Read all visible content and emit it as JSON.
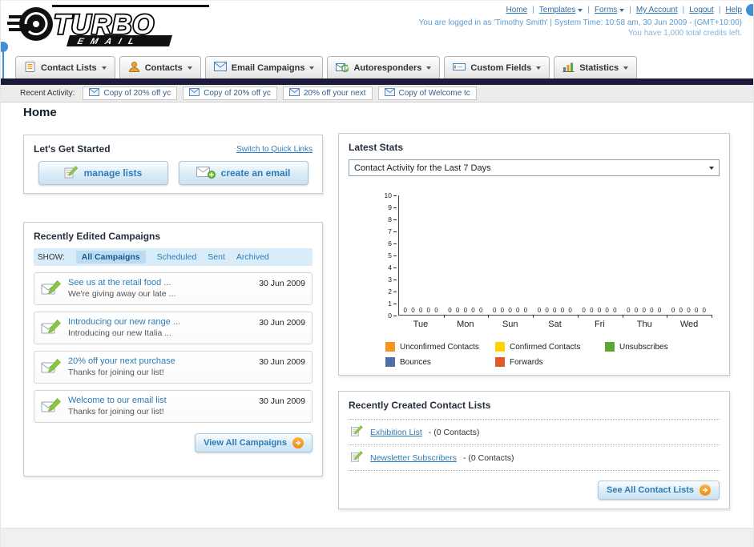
{
  "colors": {
    "link_blue": "#2d7cb8",
    "nav_strip": "#1c1c3a",
    "button_arrow_orange": "#f28a18",
    "filter_bar_blue": "#d9ecf9"
  },
  "header": {
    "logo_primary": "TURBO",
    "logo_secondary": "EMAIL",
    "separator": "|",
    "links": [
      {
        "label": "Home"
      },
      {
        "label": "Templates"
      },
      {
        "label": "Forms"
      },
      {
        "label": "My Account"
      },
      {
        "label": "Logout"
      },
      {
        "label": "Help"
      }
    ],
    "login_info": "You are logged in as 'Timothy Smith' | System Time: 10:58 am, 30 Jun 2009 - (GMT+10:00)",
    "credits_info": "You have 1,000 total credits left."
  },
  "nav_tabs": [
    {
      "label": "Contact Lists"
    },
    {
      "label": "Contacts"
    },
    {
      "label": "Email Campaigns"
    },
    {
      "label": "Autoresponders"
    },
    {
      "label": "Custom Fields"
    },
    {
      "label": "Statistics"
    }
  ],
  "recent_activity": {
    "label": "Recent Activity:",
    "items": [
      "Copy of 20% off yc",
      "Copy of 20% off yc",
      "20% off your next",
      "Copy of Welcome tc"
    ]
  },
  "page": {
    "title": "Home"
  },
  "get_started": {
    "title": "Let's Get Started",
    "quick_links_label": "Switch to Quick Links",
    "manage_lists_label": "manage lists",
    "create_email_label": "create an email"
  },
  "campaigns": {
    "title": "Recently Edited Campaigns",
    "show_label": "SHOW:",
    "filters": [
      "All Campaigns",
      "Scheduled",
      "Sent",
      "Archived"
    ],
    "selected_filter": "All Campaigns",
    "items": [
      {
        "title": "See us at the retail food ...",
        "subtitle": "We're giving away our late ...",
        "date": "30 Jun 2009"
      },
      {
        "title": "Introducing our new range ...",
        "subtitle": "Introducing our new Italia ...",
        "date": "30 Jun 2009"
      },
      {
        "title": "20% off your next purchase",
        "subtitle": "Thanks for joining our list!",
        "date": "30 Jun 2009"
      },
      {
        "title": "Welcome to our email list",
        "subtitle": "Thanks for joining our list!",
        "date": "30 Jun 2009"
      }
    ],
    "view_all_label": "View All Campaigns"
  },
  "stats": {
    "title": "Latest Stats",
    "period_selector": "Contact Activity for the Last 7 Days",
    "chart_data": {
      "type": "bar",
      "title": "Contact Activity for the Last 7 Days",
      "categories": [
        "Tue",
        "Mon",
        "Sun",
        "Sat",
        "Fri",
        "Thu",
        "Wed"
      ],
      "series": [
        {
          "name": "Unconfirmed Contacts",
          "color": "#f7941d",
          "values": [
            0,
            0,
            0,
            0,
            0,
            0,
            0
          ]
        },
        {
          "name": "Confirmed Contacts",
          "color": "#ffd200",
          "values": [
            0,
            0,
            0,
            0,
            0,
            0,
            0
          ]
        },
        {
          "name": "Unsubscribes",
          "color": "#5aa733",
          "values": [
            0,
            0,
            0,
            0,
            0,
            0,
            0
          ]
        },
        {
          "name": "Bounces",
          "color": "#4f6fa8",
          "values": [
            0,
            0,
            0,
            0,
            0,
            0,
            0
          ]
        },
        {
          "name": "Forwards",
          "color": "#e05a2b",
          "values": [
            0,
            0,
            0,
            0,
            0,
            0,
            0
          ]
        }
      ],
      "ylim": [
        0,
        10
      ],
      "y_tick_step": 1,
      "grid": false,
      "legend_position": "bottom",
      "value_labels_shown": true
    }
  },
  "contact_lists": {
    "title": "Recently Created Contact Lists",
    "items": [
      {
        "name": "Exhibition List",
        "detail": "- (0 Contacts)"
      },
      {
        "name": "Newsletter Subscribers",
        "detail": "- (0 Contacts)"
      }
    ],
    "see_all_label": "See All Contact Lists"
  }
}
